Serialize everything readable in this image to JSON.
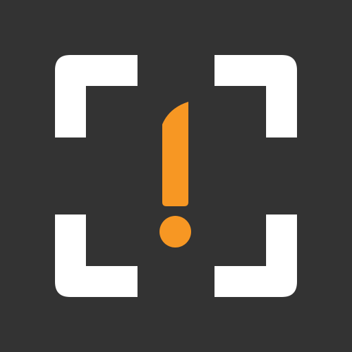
{
  "icon": {
    "glyphs": [
      "corner-bracket-icon",
      "exclamation-knife-icon"
    ],
    "colors": {
      "background": "#333333",
      "frame": "#ffffff",
      "accent": "#f79723"
    }
  }
}
